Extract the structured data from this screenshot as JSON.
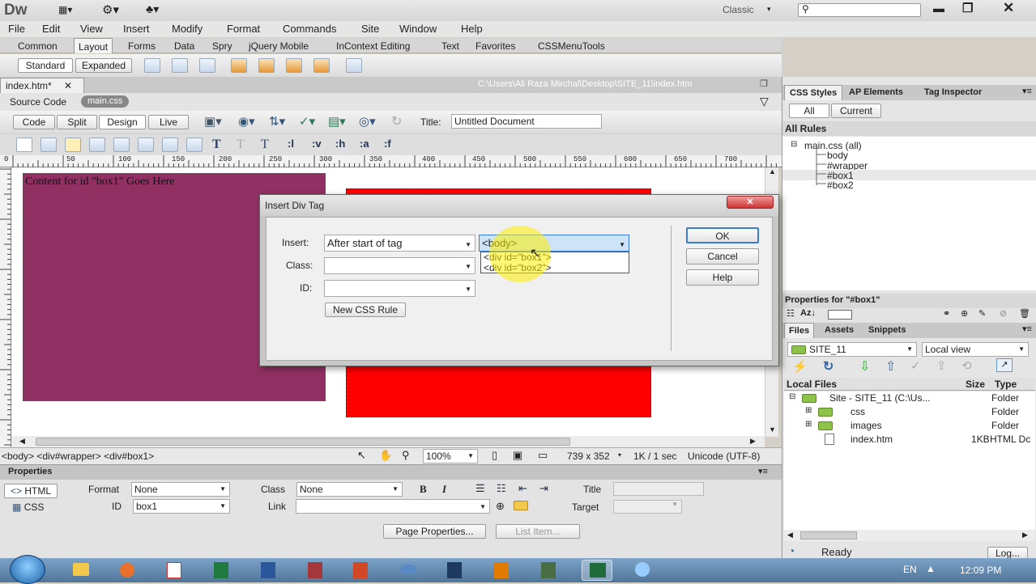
{
  "app": {
    "logo": "Dw",
    "workspace": "Classic"
  },
  "menu": [
    "File",
    "Edit",
    "View",
    "Insert",
    "Modify",
    "Format",
    "Commands",
    "Site",
    "Window",
    "Help"
  ],
  "insert_tabs": [
    "Common",
    "Layout",
    "Forms",
    "Data",
    "Spry",
    "jQuery Mobile",
    "InContext Editing",
    "Text",
    "Favorites",
    "CSSMenuTools"
  ],
  "layout_buttons": {
    "standard": "Standard",
    "expanded": "Expanded"
  },
  "doc": {
    "tab": "index.htm*",
    "path": "C:\\Users\\Ali Raza Mirchal\\Desktop\\SITE_11\\index.htm",
    "source_code": "Source Code",
    "related_file": "main.css",
    "views": [
      "Code",
      "Split",
      "Design",
      "Live"
    ],
    "title_label": "Title:",
    "title_value": "Untitled Document"
  },
  "format_buttons": [
    ":l",
    ":v",
    ":h",
    ":a",
    ":f"
  ],
  "ruler_ticks": [
    "0",
    "50",
    "100",
    "150",
    "200",
    "250",
    "300",
    "350",
    "400",
    "450",
    "500",
    "550",
    "600",
    "650",
    "700"
  ],
  "canvas": {
    "box1_text": "Content for id \"box1\" Goes Here",
    "box1_color": "#913063",
    "box2_color": "#ff0000"
  },
  "dialog": {
    "title": "Insert Div Tag",
    "insert_label": "Insert:",
    "insert_value": "After start of tag",
    "tag_value": "<body>",
    "tag_options": [
      "<div id=\"box1\">",
      "<div id=\"box2\">"
    ],
    "class_label": "Class:",
    "id_label": "ID:",
    "new_css_rule": "New CSS Rule",
    "ok": "OK",
    "cancel": "Cancel",
    "help": "Help"
  },
  "status": {
    "breadcrumb": "<body> <div#wrapper> <div#box1>",
    "zoom": "100%",
    "dimensions": "739 x 352",
    "download": "1K / 1 sec",
    "encoding": "Unicode (UTF-8)"
  },
  "properties": {
    "header": "Properties",
    "html_btn": "HTML",
    "css_btn": "CSS",
    "format_label": "Format",
    "format_value": "None",
    "class_label": "Class",
    "class_value": "None",
    "id_label": "ID",
    "id_value": "box1",
    "link_label": "Link",
    "title_label": "Title",
    "target_label": "Target",
    "bold": "B",
    "italic": "I",
    "page_properties": "Page Properties...",
    "list_item": "List Item..."
  },
  "css_panel": {
    "tabs": [
      "CSS Styles",
      "AP Elements",
      "Tag Inspector"
    ],
    "all": "All",
    "current": "Current",
    "all_rules": "All Rules",
    "root": "main.css (all)",
    "rules": [
      "body",
      "#wrapper",
      "#box1",
      "#box2"
    ],
    "properties_for": "Properties for \"#box1\"",
    "az": "Az↓"
  },
  "files_panel": {
    "tabs": [
      "Files",
      "Assets",
      "Snippets"
    ],
    "site": "SITE_11",
    "view": "Local view",
    "cols": {
      "name": "Local Files",
      "size": "Size",
      "type": "Type"
    },
    "rows": [
      {
        "name": "Site - SITE_11 (C:\\Us...",
        "size": "",
        "type": "Folder"
      },
      {
        "name": "css",
        "size": "",
        "type": "Folder"
      },
      {
        "name": "images",
        "size": "",
        "type": "Folder"
      },
      {
        "name": "index.htm",
        "size": "1KB",
        "type": "HTML Dc"
      }
    ],
    "ready": "Ready",
    "log": "Log..."
  },
  "taskbar": {
    "lang": "EN",
    "time": "12:09 PM"
  }
}
